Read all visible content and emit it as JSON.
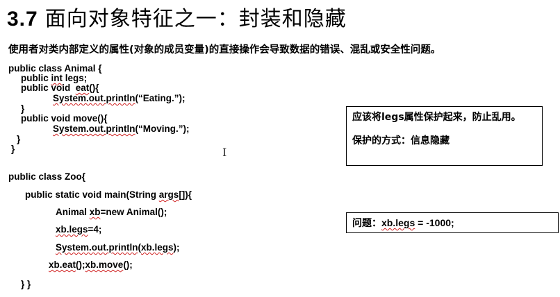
{
  "slide": {
    "title_number": "3.7",
    "title_text": "面向对象特征之一：封装和隐藏",
    "intro": "使用者对类内部定义的属性(对象的成员变量)的直接操作会导致数据的错误、混乱或安全性问题。"
  },
  "animal_code": {
    "l1": "public class Animal {",
    "l2a": "public ",
    "l2b": "int",
    "l2c": " legs;",
    "l3a": "public void  ",
    "l3b": "eat",
    "l3c": "(){",
    "l4a": "System.out.println",
    "l4b": "(“Eating.”);",
    "l5": "}",
    "l6": "public void move(){",
    "l7a": "System.out.println",
    "l7b": "(“Moving.”);",
    "l8": "}",
    "l9": "}"
  },
  "zoo_code": {
    "l1": "public class Zoo{",
    "l2a": "public static void main(String ",
    "l2b": "args",
    "l2c": "[]){",
    "l3a": "Animal ",
    "l3b": "xb",
    "l3c": "=new Animal();",
    "l4a": "xb.legs",
    "l4b": "=4;",
    "l5a": "System.out.println",
    "l5b": "(",
    "l5c": "xb.legs",
    "l5d": ");",
    "l6a": "xb.eat",
    "l6b": "();",
    "l6c": "xb.move",
    "l6d": "();",
    "l7": "} }"
  },
  "note_box": {
    "line1": "应该将legs属性保护起来，防止乱用。",
    "line2": "保护的方式：信息隐藏"
  },
  "problem_box": {
    "label": "问题：",
    "code": "xb.legs",
    "value": " = -1000;"
  },
  "cursor_glyph": "I"
}
